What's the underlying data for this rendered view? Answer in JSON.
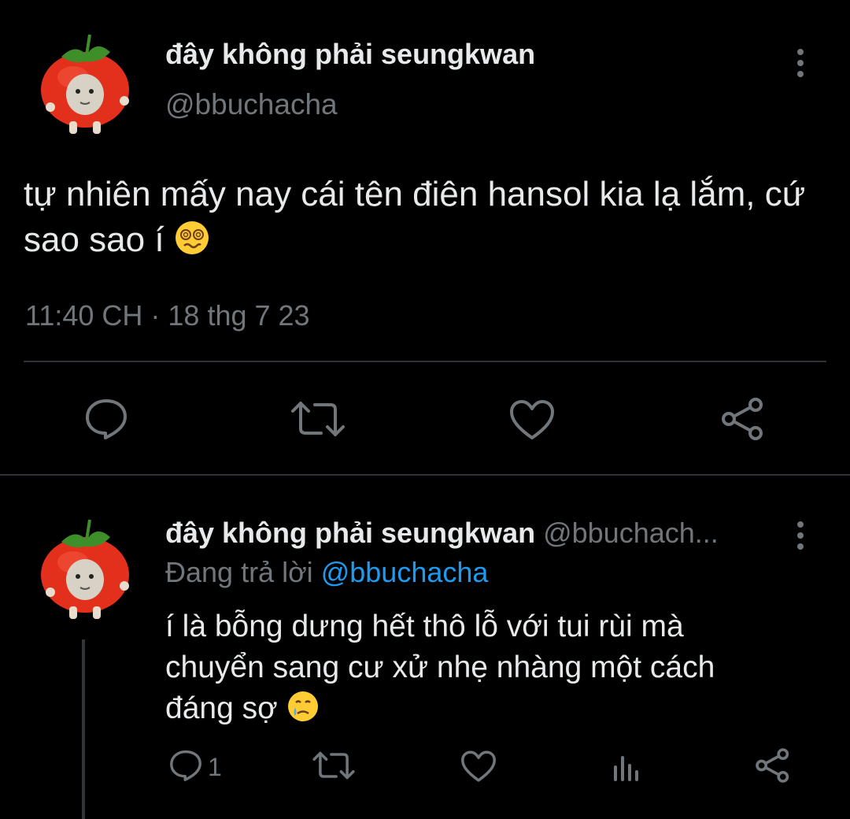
{
  "main_tweet": {
    "display_name": "đây không phải seungkwan",
    "handle": "@bbuchacha",
    "text": "tự nhiên mấy nay cái tên điên hansol kia lạ lắm, cứ sao sao í",
    "emoji": "dizzy-face",
    "timestamp": "11:40 CH · 18 thg 7 23",
    "actions": {
      "reply_icon": "comment-icon",
      "retweet_icon": "retweet-icon",
      "like_icon": "heart-icon",
      "share_icon": "share-icon"
    }
  },
  "reply_tweet": {
    "display_name": "đây không phải seungkwan",
    "handle": "@bbuchach...",
    "replying_prefix": "Đang trả lời",
    "replying_to": "@bbuchacha",
    "text_lines": [
      "í là bỗng dưng hết thô lỗ với tui rùi mà",
      "chuyển sang cư xử nhẹ nhàng một cách",
      "đáng sợ"
    ],
    "emoji": "sad-tear-face",
    "reply_count": "1",
    "actions": {
      "reply_icon": "comment-icon",
      "retweet_icon": "retweet-icon",
      "like_icon": "heart-icon",
      "views_icon": "analytics-icon",
      "share_icon": "share-icon"
    }
  },
  "colors": {
    "background": "#000000",
    "text": "#e7e9ea",
    "muted": "#71767b",
    "link": "#1d9bf0",
    "divider": "#2f3336"
  }
}
